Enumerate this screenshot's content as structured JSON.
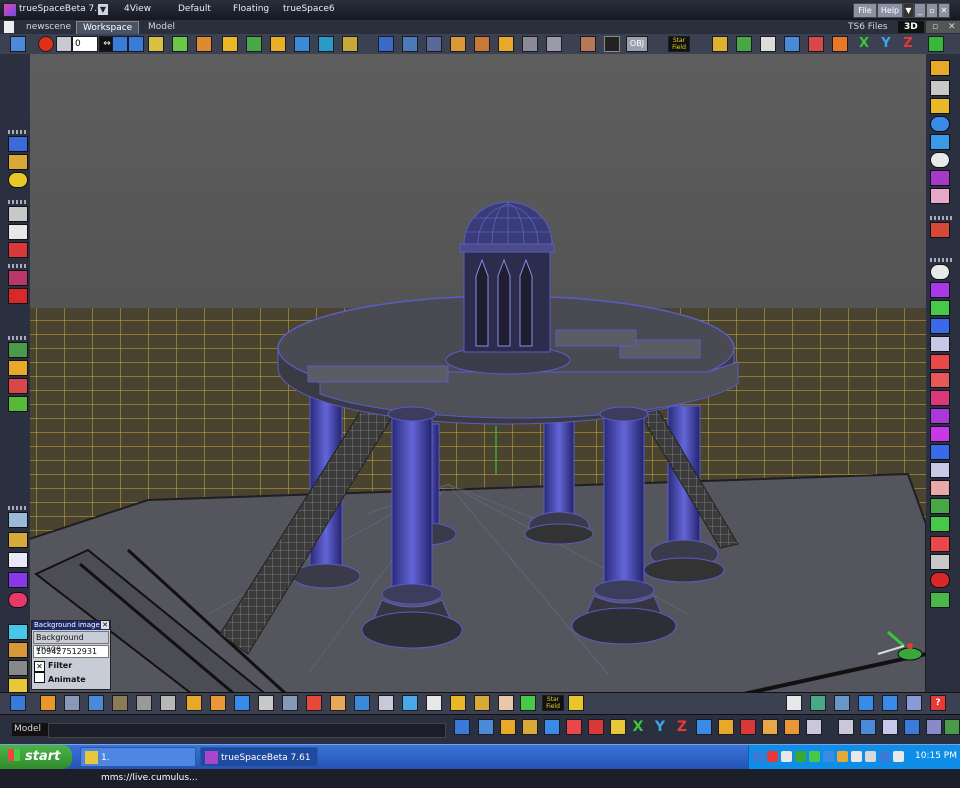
{
  "window": {
    "title": "trueSpaceBeta 7.61",
    "layouts": [
      "4View",
      "Default",
      "Floating",
      "trueSpace6"
    ],
    "menu": [
      "File",
      "Help"
    ]
  },
  "tabs": {
    "scene": "newscene",
    "items": [
      "Workspace",
      "Model"
    ],
    "right_label": "TS6 Files",
    "mode_label": "3D"
  },
  "toolbar": {
    "frame_value": "0",
    "obj_label": "OBJ",
    "starfield_label": "Star Field",
    "axis_labels": [
      "X",
      "Y",
      "Z"
    ]
  },
  "background_panel": {
    "header": "Background image",
    "field_label": "Background image",
    "value": "109427512931",
    "filter_label": "Filter",
    "filter_checked": true,
    "animate_label": "Animate",
    "animate_checked": false
  },
  "bottom_toolbar": {
    "starfield_label": "Star Field",
    "axis_labels": [
      "X",
      "Y",
      "Z"
    ]
  },
  "status": {
    "mode": "Model"
  },
  "taskbar": {
    "start_label": "start",
    "tasks": [
      {
        "label": "1. mms://live.cumulus...",
        "active": false
      },
      {
        "label": "trueSpaceBeta 7.61",
        "active": true
      }
    ],
    "clock": "10:15 PM"
  },
  "colors": {
    "model_stroke": "#5a5cc8",
    "grid_yellow": "#c9b13a",
    "floor_back": "#4b4a45",
    "sky": "#5f5f5f"
  }
}
